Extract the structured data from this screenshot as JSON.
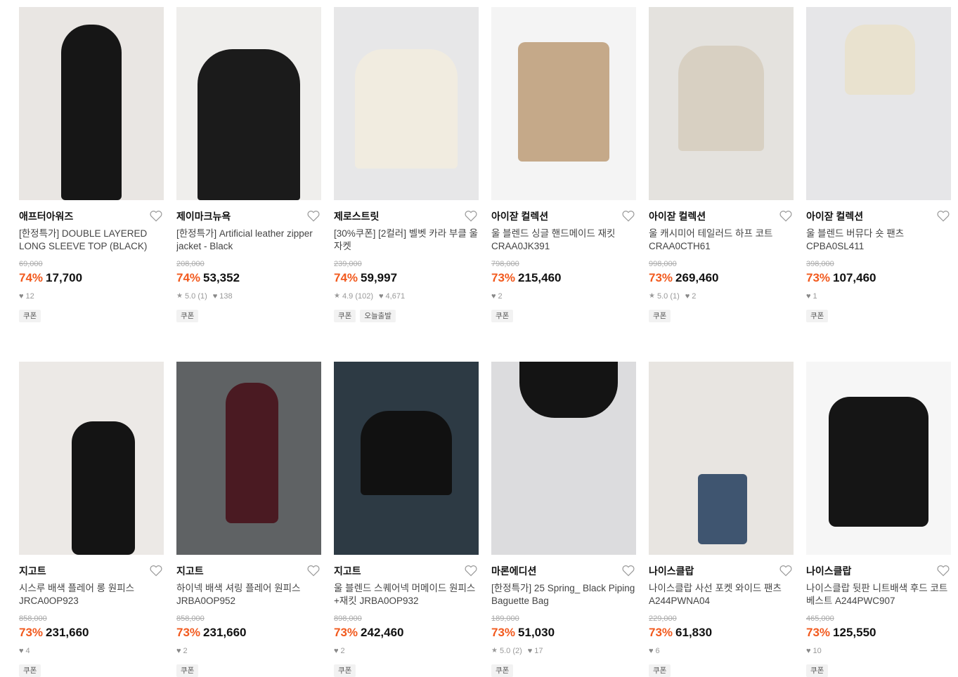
{
  "products": [
    {
      "brand": "애프터아워즈",
      "name": "[한정특가] DOUBLE LAYERED LONG SLEEVE TOP (BLACK)",
      "original": "69,000",
      "discount": "74%",
      "price": "17,700",
      "rating": "",
      "likes": "12",
      "tags": [
        "쿠폰"
      ],
      "bg": "#e9e6e3",
      "fig": "#161616"
    },
    {
      "brand": "제이마크뉴욕",
      "name": "[한정특가] Artificial leather zipper jacket - Black",
      "original": "208,000",
      "discount": "74%",
      "price": "53,352",
      "rating": "5.0 (1)",
      "likes": "138",
      "tags": [
        "쿠폰"
      ],
      "bg": "#efeeec",
      "fig": "#1b1b1b"
    },
    {
      "brand": "제로스트릿",
      "name": "[30%쿠폰] [2컬러] 벨벳 카라 부클 울 자켓",
      "original": "239,000",
      "discount": "74%",
      "price": "59,997",
      "rating": "4.9 (102)",
      "likes": "4,671",
      "tags": [
        "쿠폰",
        "오늘출발"
      ],
      "bg": "#e7e7e8",
      "fig": "#f1ece0"
    },
    {
      "brand": "아이잗 컬렉션",
      "name": "울 블렌드 싱글 핸드메이드 재킷 CRAA0JK391",
      "original": "798,000",
      "discount": "73%",
      "price": "215,460",
      "rating": "",
      "likes": "2",
      "tags": [
        "쿠폰"
      ],
      "bg": "#f4f4f4",
      "fig": "#c5a989"
    },
    {
      "brand": "아이잗 컬렉션",
      "name": "울 캐시미어 테일러드 하프 코트 CRAA0CTH61",
      "original": "998,000",
      "discount": "73%",
      "price": "269,460",
      "rating": "5.0 (1)",
      "likes": "2",
      "tags": [
        "쿠폰"
      ],
      "bg": "#e4e2de",
      "fig": "#d8d0c2"
    },
    {
      "brand": "아이잗 컬렉션",
      "name": "울 블렌드 버뮤다 숏 팬츠 CPBA0SL411",
      "original": "398,000",
      "discount": "73%",
      "price": "107,460",
      "rating": "",
      "likes": "1",
      "tags": [
        "쿠폰"
      ],
      "bg": "#e6e6e8",
      "fig": "#e9e2cf"
    },
    {
      "brand": "지고트",
      "name": "시스루 배색 플레어 롱 원피스 JRCA0OP923",
      "original": "858,000",
      "discount": "73%",
      "price": "231,660",
      "rating": "",
      "likes": "4",
      "tags": [
        "쿠폰"
      ],
      "bg": "#ece9e6",
      "fig": "#141414"
    },
    {
      "brand": "지고트",
      "name": "하이넥 배색 셔링 플레어 원피스 JRBA0OP952",
      "original": "858,000",
      "discount": "73%",
      "price": "231,660",
      "rating": "",
      "likes": "2",
      "tags": [
        "쿠폰"
      ],
      "bg": "#5f6264",
      "fig": "#4a1a22"
    },
    {
      "brand": "지고트",
      "name": "울 블렌드 스퀘어넥 머메이드 원피스+재킷 JRBA0OP932",
      "original": "898,000",
      "discount": "73%",
      "price": "242,460",
      "rating": "",
      "likes": "2",
      "tags": [
        "쿠폰"
      ],
      "bg": "#2d3a44",
      "fig": "#111111"
    },
    {
      "brand": "마론에디션",
      "name": "[한정특가] 25 Spring_ Black Piping Baguette Bag",
      "original": "189,000",
      "discount": "73%",
      "price": "51,030",
      "rating": "5.0 (2)",
      "likes": "17",
      "tags": [
        "쿠폰"
      ],
      "bg": "#dcdcde",
      "fig": "#141414"
    },
    {
      "brand": "나이스클랍",
      "name": "나이스클랍 사선 포켓 와이드 팬츠 A244PWNA04",
      "original": "229,000",
      "discount": "73%",
      "price": "61,830",
      "rating": "",
      "likes": "6",
      "tags": [
        "쿠폰"
      ],
      "bg": "#e8e5e1",
      "fig": "#3f5570"
    },
    {
      "brand": "나이스클랍",
      "name": "나이스클랍 뒷판 니트배색 후드 코트베스트 A244PWC907",
      "original": "465,000",
      "discount": "73%",
      "price": "125,550",
      "rating": "",
      "likes": "10",
      "tags": [
        "쿠폰"
      ],
      "bg": "#f6f6f6",
      "fig": "#151515"
    }
  ]
}
